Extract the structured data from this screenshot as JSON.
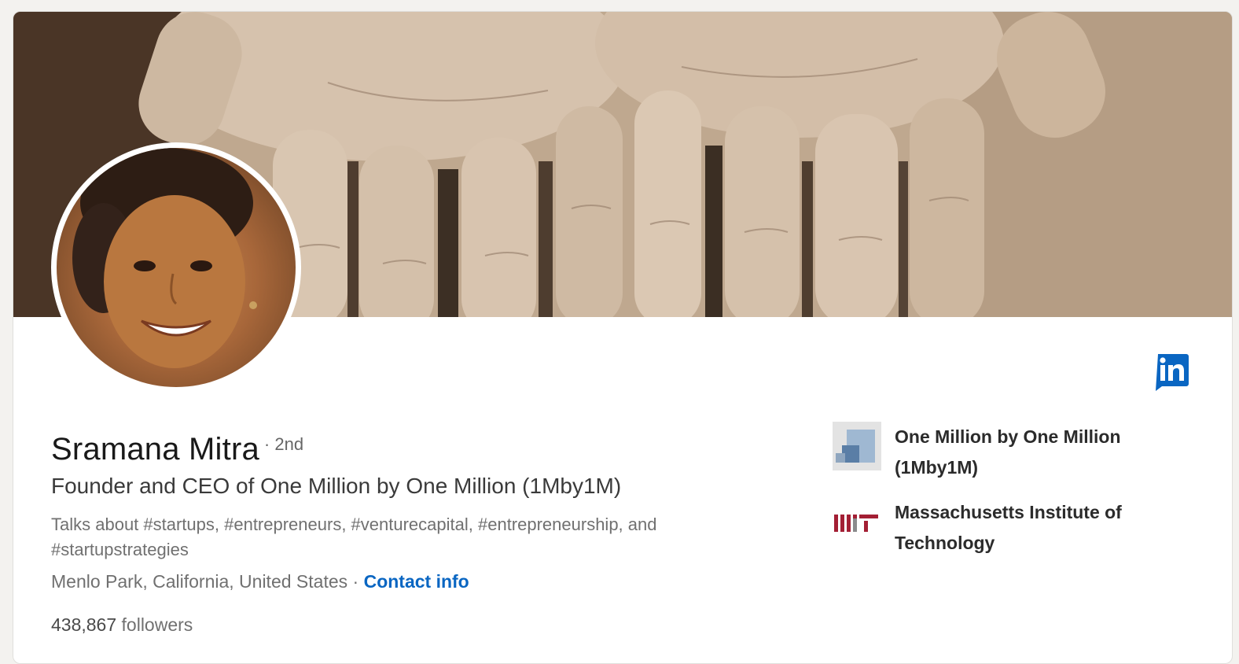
{
  "profile": {
    "name": "Sramana Mitra",
    "degree": "· 2nd",
    "headline": "Founder and CEO of One Million by One Million (1Mby1M)",
    "talks_about": "Talks about #startups, #entrepreneurs, #venturecapital, #entrepreneurship, and #startupstrategies",
    "location": "Menlo Park, California, United States",
    "separator": " · ",
    "contact_info_label": "Contact info",
    "followers_count": "438,867",
    "followers_label": " followers"
  },
  "organizations": [
    {
      "name": "One Million by One Million (1Mby1M)",
      "logo_icon": "1mby1m-logo-icon"
    },
    {
      "name": "Massachusetts Institute of Technology",
      "logo_icon": "mit-logo-icon"
    }
  ],
  "icons": {
    "linkedin": "linkedin-icon"
  },
  "colors": {
    "link_blue": "#0a66c2",
    "linkedin_blue": "#0a66c2",
    "mit_red": "#a31f34",
    "page_bg": "#f3f2ef",
    "text_primary": "#191919",
    "text_secondary": "#707070"
  }
}
